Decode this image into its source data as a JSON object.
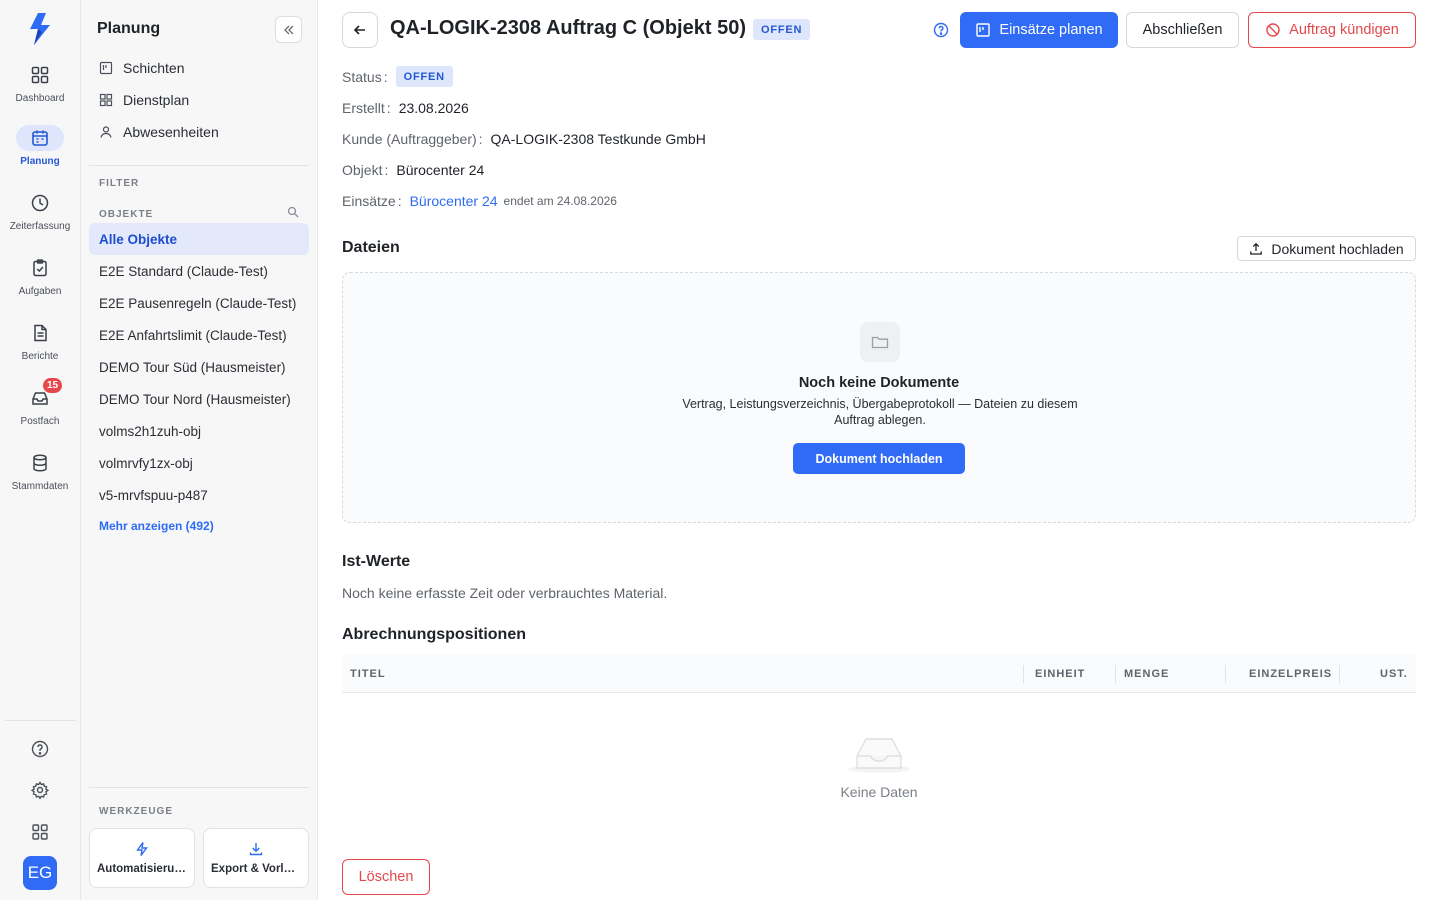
{
  "rail": {
    "items": [
      {
        "label": "Dashboard",
        "icon": "grid-icon"
      },
      {
        "label": "Planung",
        "icon": "calendar-icon"
      },
      {
        "label": "Zeiterfassung",
        "icon": "clock-icon"
      },
      {
        "label": "Aufgaben",
        "icon": "clipboard-check-icon"
      },
      {
        "label": "Berichte",
        "icon": "document-icon"
      },
      {
        "label": "Postfach",
        "icon": "inbox-icon",
        "badge": "15"
      },
      {
        "label": "Stammdaten",
        "icon": "database-icon"
      }
    ],
    "avatar": "EG"
  },
  "sidebar": {
    "title": "Planung",
    "nav": [
      {
        "label": "Schichten",
        "icon": "board-icon"
      },
      {
        "label": "Dienstplan",
        "icon": "grid-icon"
      },
      {
        "label": "Abwesenheiten",
        "icon": "user-icon"
      }
    ],
    "filter_label": "FILTER",
    "objects_label": "OBJEKTE",
    "objects": [
      "Alle Objekte",
      "E2E Standard (Claude-Test)",
      "E2E Pausenregeln (Claude-Test)",
      "E2E Anfahrtslimit (Claude-Test)",
      "DEMO Tour Süd (Hausmeister)",
      "DEMO Tour Nord (Hausmeister)",
      "volms2h1zuh-obj",
      "volmrvfy1zx-obj",
      "v5-mrvfspuu-p487"
    ],
    "more_label": "Mehr anzeigen (492)",
    "tools_label": "WERKZEUGE",
    "tools": [
      {
        "label": "Automatisierungen",
        "icon": "bolt-icon"
      },
      {
        "label": "Export & Vorlagen",
        "icon": "download-icon"
      }
    ]
  },
  "header": {
    "title": "QA-LOGIK-2308 Auftrag C (Objekt 50)",
    "status": "OFFEN",
    "plan_button": "Einsätze planen",
    "close_button": "Abschließen",
    "cancel_button": "Auftrag kündigen"
  },
  "meta": {
    "status_label": "Status",
    "status_value": "OFFEN",
    "created_label": "Erstellt",
    "created_value": "23.08.2026",
    "customer_label": "Kunde (Auftraggeber)",
    "customer_value": "QA-LOGIK-2308 Testkunde GmbH",
    "object_label": "Objekt",
    "object_value": "Bürocenter 24",
    "assignments_label": "Einsätze",
    "assignments_link": "Bürocenter 24",
    "assignments_sub": "endet am 24.08.2026"
  },
  "files": {
    "title": "Dateien",
    "upload_button": "Dokument hochladen",
    "empty_title": "Noch keine Dokumente",
    "empty_text": "Vertrag, Leistungsverzeichnis, Übergabeprotokoll — Dateien zu diesem Auftrag ablegen.",
    "empty_button": "Dokument hochladen"
  },
  "actuals": {
    "title": "Ist-Werte",
    "text": "Noch keine erfasste Zeit oder verbrauchtes Material."
  },
  "billing": {
    "title": "Abrechnungspositionen",
    "columns": [
      "TITEL",
      "EINHEIT",
      "MENGE",
      "EINZELPREIS",
      "UST."
    ],
    "empty": "Keine Daten"
  },
  "footer": {
    "delete_button": "Löschen"
  },
  "colors": {
    "primary": "#2f6bf5",
    "danger": "#e5484d",
    "active_bg": "#e3e8fb"
  }
}
